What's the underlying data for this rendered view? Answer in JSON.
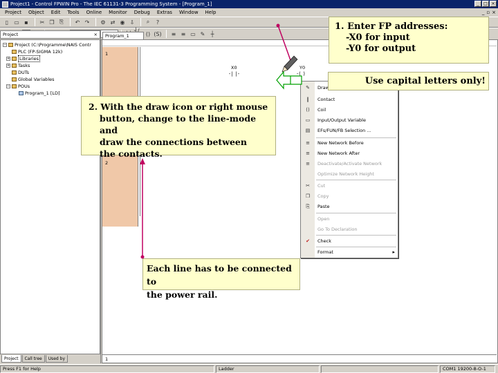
{
  "window": {
    "title": "Project1 - Control FPWIN Pro - The IEC 61131-3 Programming System - [Program_1]"
  },
  "menubar": {
    "items": [
      "Project",
      "Object",
      "Edit",
      "Tools",
      "Online",
      "Monitor",
      "Debug",
      "Extras",
      "Window",
      "Help"
    ]
  },
  "project_pane": {
    "header": "Project",
    "close_glyph": "×",
    "tree": [
      {
        "label": "Project (C:\\Programme\\NAIS Contr",
        "expander": "−",
        "depth": 0
      },
      {
        "label": "PLC (FP-SIGMA 12k)",
        "expander": "",
        "depth": 1
      },
      {
        "label": "Libraries",
        "expander": "+",
        "depth": 1
      },
      {
        "label": "Tasks",
        "expander": "+",
        "depth": 1
      },
      {
        "label": "DUTs",
        "expander": "",
        "depth": 1
      },
      {
        "label": "Global Variables",
        "expander": "",
        "depth": 1
      },
      {
        "label": "POUs",
        "expander": "−",
        "depth": 1
      },
      {
        "label": "Program_1 [LD]",
        "expander": "",
        "depth": 2
      }
    ],
    "tabs": [
      "Project",
      "Call tree",
      "Used by"
    ]
  },
  "editor": {
    "tab_label": "Program_1",
    "networks": [
      "1",
      "2"
    ],
    "bottom_row_number": "1",
    "contact_x0": "X0",
    "coil_y0": "Y0",
    "contact_symbol": "-| |-",
    "coil_symbol": "-( )"
  },
  "context_menu": {
    "items": [
      {
        "label": "Draw Line",
        "icon": "pencil-icon",
        "glyph": "✎",
        "disabled": false,
        "sub": false
      },
      {
        "label": "Contact",
        "icon": "contact-icon",
        "glyph": "‖",
        "disabled": false,
        "sub": false
      },
      {
        "label": "Coil",
        "icon": "coil-icon",
        "glyph": "()",
        "disabled": false,
        "sub": false
      },
      {
        "label": "Input/Output Variable",
        "icon": "variable-icon",
        "glyph": "▭",
        "disabled": false,
        "sub": false
      },
      {
        "label": "EFs/FUN/FB Selection ...",
        "icon": "function-block-icon",
        "glyph": "▤",
        "disabled": false,
        "sub": false
      },
      {
        "label": "New Network Before",
        "icon": "network-before-icon",
        "glyph": "≡",
        "disabled": false,
        "sub": false
      },
      {
        "label": "New Network After",
        "icon": "network-after-icon",
        "glyph": "≡",
        "disabled": false,
        "sub": false
      },
      {
        "label": "Deactivate/Activate Network",
        "icon": "deactivate-icon",
        "glyph": "≡",
        "disabled": true,
        "sub": false
      },
      {
        "label": "Optimize Network Height",
        "icon": "optimize-icon",
        "glyph": "",
        "disabled": true,
        "sub": false
      },
      {
        "label": "Cut",
        "icon": "scissors-icon",
        "glyph": "✂",
        "disabled": true,
        "sub": false
      },
      {
        "label": "Copy",
        "icon": "copy-icon",
        "glyph": "❐",
        "disabled": true,
        "sub": false
      },
      {
        "label": "Paste",
        "icon": "paste-icon",
        "glyph": "⎘",
        "disabled": false,
        "sub": false
      },
      {
        "label": "Open",
        "icon": "open-icon",
        "glyph": "",
        "disabled": true,
        "sub": false
      },
      {
        "label": "Go To Declaration",
        "icon": "goto-icon",
        "glyph": "",
        "disabled": true,
        "sub": false
      },
      {
        "label": "Check",
        "icon": "check-icon",
        "glyph": "✔",
        "disabled": false,
        "sub": false
      },
      {
        "label": "Format",
        "icon": "format-icon",
        "glyph": "",
        "disabled": false,
        "sub": true
      }
    ]
  },
  "status_bar": {
    "left": "Press F1 for Help",
    "mode": "Ladder",
    "connection": "COM1 19200-8-O-1"
  },
  "annotations": {
    "callout1": [
      "1. Enter FP addresses:",
      "-X0 for input",
      "-Y0 for output"
    ],
    "callout_caps": "Use capital letters only!",
    "callout2": [
      "2. With the draw icon or right mouse",
      "button, change to the line-mode and",
      "draw the connections between",
      "the contacts."
    ],
    "callout3": [
      "Each line has to be connected to",
      "the power rail."
    ]
  }
}
